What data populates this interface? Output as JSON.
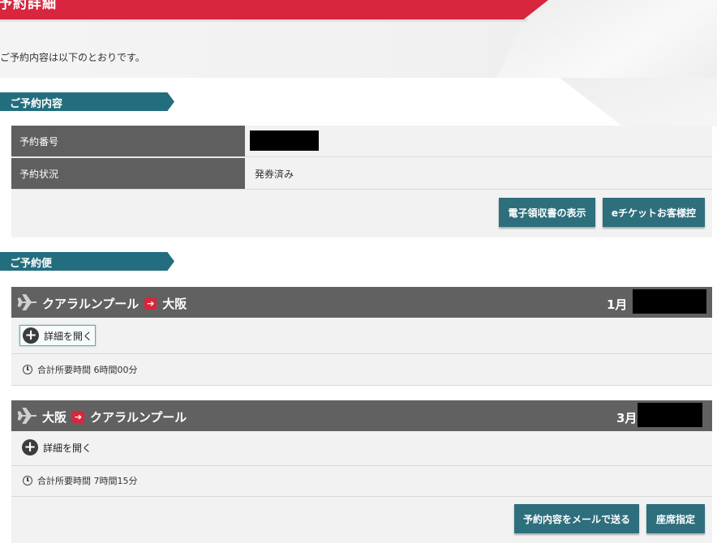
{
  "header": {
    "title": "予約詳細",
    "intro": "ご予約内容は以下のとおりです。"
  },
  "reservation": {
    "section_title": "ご予約内容",
    "rows": [
      {
        "label": "予約番号",
        "value": ""
      },
      {
        "label": "予約状況",
        "value": "発券済み"
      }
    ],
    "buttons": {
      "receipt": "電子領収書の表示",
      "eticket": "eチケットお客様控"
    }
  },
  "flights": {
    "section_title": "ご予約便",
    "items": [
      {
        "from": "クアラルンプール",
        "to": "大阪",
        "date_prefix": "1月",
        "arrow": "➔",
        "toggle_label": "詳細を開く",
        "plus": "+",
        "duration": "合計所要時間 6時間00分"
      },
      {
        "from": "大阪",
        "to": "クアラルンプール",
        "date_prefix": "3月",
        "arrow": "➔",
        "toggle_label": "詳細を開く",
        "plus": "+",
        "duration": "合計所要時間 7時間15分"
      }
    ],
    "buttons": {
      "email": "予約内容をメールで送る",
      "seat": "座席指定"
    }
  },
  "colors": {
    "brand_red": "#d7263d",
    "section_teal": "#236e7e",
    "button_teal": "#2e6f7d",
    "header_gray": "#616161"
  },
  "icons": [
    "airplane-icon",
    "arrow-right-icon",
    "plus-circle-icon",
    "clock-icon"
  ]
}
